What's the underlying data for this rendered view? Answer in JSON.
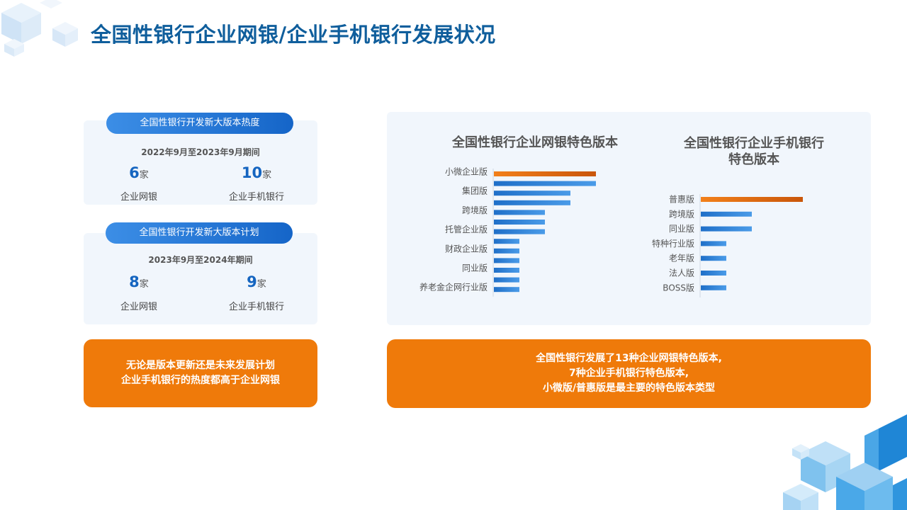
{
  "title": "全国性银行企业网银/企业手机银行发展状况",
  "card1": {
    "pill": "全国性银行开发新大版本热度",
    "period": "2022年9月至2023年9月期间",
    "left": {
      "value": "6",
      "unit": "家",
      "label": "企业网银"
    },
    "right": {
      "value": "10",
      "unit": "家",
      "label": "企业手机银行"
    }
  },
  "card2": {
    "pill": "全国性银行开发新大版本计划",
    "period": "2023年9月至2024年期间",
    "left": {
      "value": "8",
      "unit": "家",
      "label": "企业网银"
    },
    "right": {
      "value": "9",
      "unit": "家",
      "label": "企业手机银行"
    }
  },
  "note_left": [
    "无论是版本更新还是未来发展计划",
    "企业手机银行的热度都高于企业网银"
  ],
  "note_right": [
    "全国性银行发展了13种企业网银特色版本,",
    "7种企业手机银行特色版本,",
    "小微版/普惠版是最主要的特色版本类型"
  ],
  "colors": {
    "highlight": "#e8700e",
    "bar": "#2a7fd6",
    "title": "#0f5e9c",
    "orange": "#ef7a0a"
  },
  "chart_data": [
    {
      "type": "bar",
      "orientation": "horizontal",
      "title": "全国性银行企业网银特色版本",
      "categories": [
        "小微企业版",
        "",
        "集团版",
        "",
        "跨境版",
        "",
        "托管企业版",
        "",
        "财政企业版",
        "",
        "同业版",
        "",
        "养老金企网行业版"
      ],
      "values": [
        4,
        4,
        3,
        3,
        2,
        2,
        2,
        1,
        1,
        1,
        1,
        1,
        1
      ],
      "highlight_index": 0
    },
    {
      "type": "bar",
      "orientation": "horizontal",
      "title": "全国性银行企业手机银行特色版本",
      "categories": [
        "普惠版",
        "跨境版",
        "同业版",
        "特种行业版",
        "老年版",
        "法人版",
        "BOSS版"
      ],
      "values": [
        4,
        2,
        2,
        1,
        1,
        1,
        1
      ],
      "highlight_index": 0
    }
  ]
}
